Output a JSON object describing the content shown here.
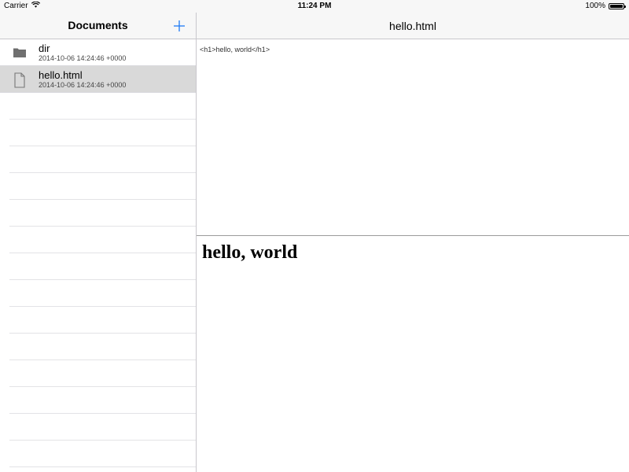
{
  "status_bar": {
    "carrier": "Carrier",
    "time": "11:24 PM",
    "battery_percent": "100%",
    "battery_level": 1.0
  },
  "sidebar": {
    "title": "Documents",
    "add_icon": "plus-icon",
    "items": [
      {
        "name": "dir",
        "date": "2014-10-06 14:24:46 +0000",
        "icon": "folder-icon",
        "selected": false
      },
      {
        "name": "hello.html",
        "date": "2014-10-06 14:24:46 +0000",
        "icon": "document-icon",
        "selected": true
      }
    ]
  },
  "detail": {
    "title": "hello.html",
    "source_text": "<h1>hello, world</h1>",
    "preview_heading": "hello, world"
  },
  "colors": {
    "accent": "#1f7af5",
    "selected_row": "#d9d9d9",
    "separator": "#c8c7cc"
  }
}
